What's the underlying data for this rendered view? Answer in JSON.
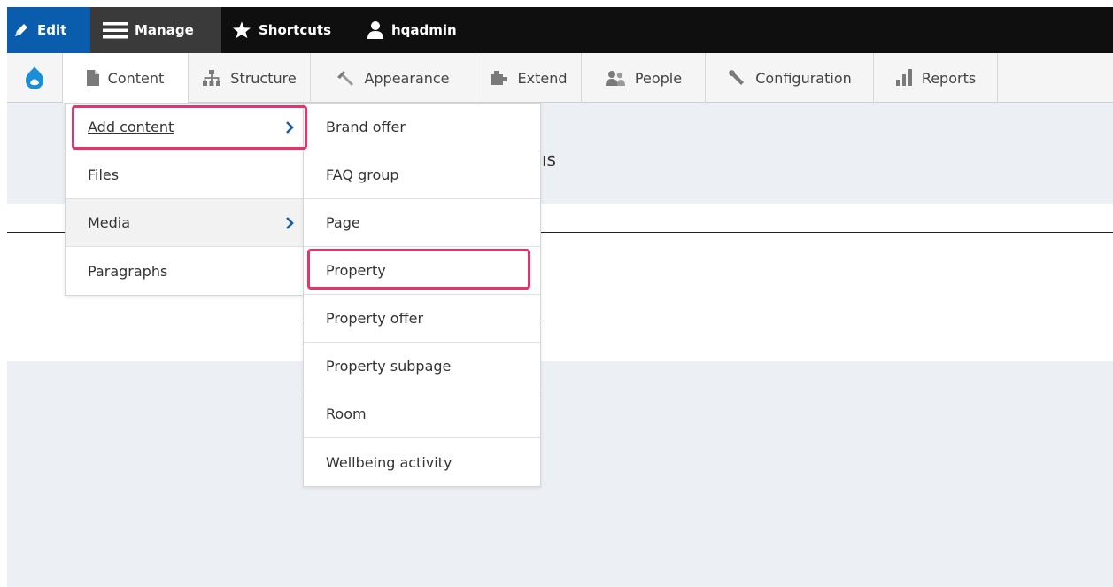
{
  "toolbar": {
    "edit_label": "Edit",
    "manage_label": "Manage",
    "shortcuts_label": "Shortcuts",
    "user_label": "hqadmin"
  },
  "tray": {
    "tabs": [
      {
        "label": "Content",
        "icon": "page-icon"
      },
      {
        "label": "Structure",
        "icon": "sitemap-icon"
      },
      {
        "label": "Appearance",
        "icon": "brush-icon"
      },
      {
        "label": "Extend",
        "icon": "puzzle-icon"
      },
      {
        "label": "People",
        "icon": "people-icon"
      },
      {
        "label": "Configuration",
        "icon": "wrench-icon"
      },
      {
        "label": "Reports",
        "icon": "bar-chart-icon"
      }
    ]
  },
  "page": {
    "title_fragment": "ıs"
  },
  "content_menu": {
    "items": [
      {
        "label": "Add content",
        "has_submenu": true
      },
      {
        "label": "Files",
        "has_submenu": false
      },
      {
        "label": "Media",
        "has_submenu": true
      },
      {
        "label": "Paragraphs",
        "has_submenu": false
      }
    ]
  },
  "add_content_menu": {
    "items": [
      {
        "label": "Brand offer"
      },
      {
        "label": "FAQ group"
      },
      {
        "label": "Page"
      },
      {
        "label": "Property"
      },
      {
        "label": "Property offer"
      },
      {
        "label": "Property subpage"
      },
      {
        "label": "Room"
      },
      {
        "label": "Wellbeing activity"
      }
    ]
  },
  "colors": {
    "edit_bg": "#0a5dad",
    "highlight": "#e6336a",
    "drupal_blue": "#1a8fd8",
    "chevron": "#1b5ea8"
  }
}
